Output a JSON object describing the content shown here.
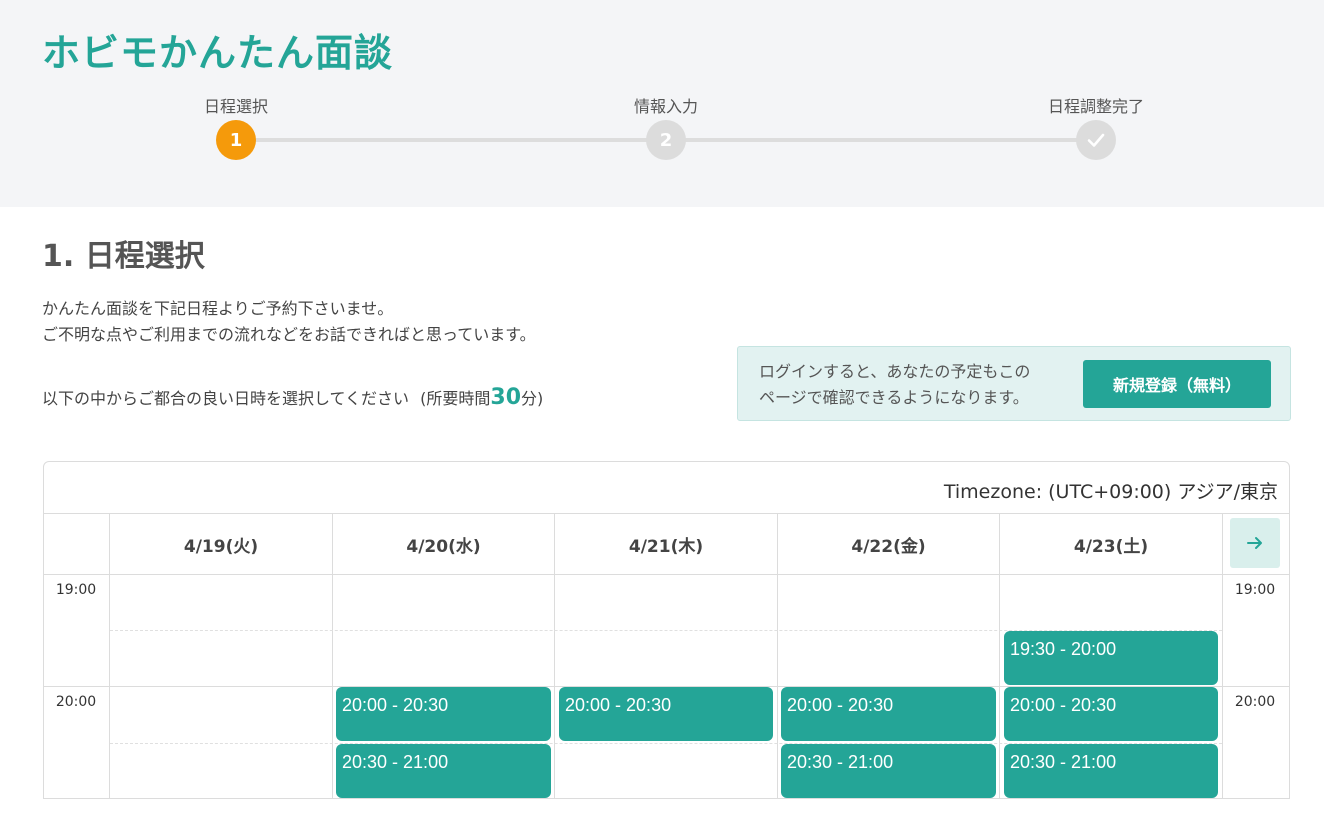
{
  "app": {
    "title": "ホビモかんたん面談"
  },
  "steps": [
    {
      "label": "日程選択",
      "number": "1",
      "state": "active"
    },
    {
      "label": "情報入力",
      "number": "2",
      "state": "inactive"
    },
    {
      "label": "日程調整完了",
      "number": "",
      "icon": "check-icon",
      "state": "inactive"
    }
  ],
  "section": {
    "title": "1. 日程選択",
    "intro_line1": "かんたん面談を下記日程よりご予約下さいませ。",
    "intro_line2": "ご不明な点やご利用までの流れなどをお話できればと思っています。",
    "select_prefix": "以下の中からご都合の良い日時を選択してください",
    "duration_prefix": "(所要時間",
    "duration_value": "30",
    "duration_suffix": "分)"
  },
  "login": {
    "line1": "ログインすると、あなたの予定もこの",
    "line2": "ページで確認できるようになります。",
    "register_label": "新規登録（無料）"
  },
  "calendar": {
    "timezone": "Timezone: (UTC+09:00) アジア/東京",
    "days": [
      "4/19(火)",
      "4/20(水)",
      "4/21(木)",
      "4/22(金)",
      "4/23(土)"
    ],
    "hours": [
      "19:00",
      "20:00"
    ],
    "next_icon": "arrow-right-icon",
    "slots": [
      {
        "day": 4,
        "start": "19:30",
        "label": "19:30 - 20:00"
      },
      {
        "day": 1,
        "start": "20:00",
        "label": "20:00 - 20:30"
      },
      {
        "day": 2,
        "start": "20:00",
        "label": "20:00 - 20:30"
      },
      {
        "day": 3,
        "start": "20:00",
        "label": "20:00 - 20:30"
      },
      {
        "day": 4,
        "start": "20:00",
        "label": "20:00 - 20:30"
      },
      {
        "day": 1,
        "start": "20:30",
        "label": "20:30 - 21:00"
      },
      {
        "day": 3,
        "start": "20:30",
        "label": "20:30 - 21:00"
      },
      {
        "day": 4,
        "start": "20:30",
        "label": "20:30 - 21:00"
      }
    ]
  },
  "colors": {
    "accent": "#24a597",
    "step_active": "#f59a0b",
    "step_inactive": "#dcdcdc",
    "header_bg": "#f4f5f7"
  }
}
